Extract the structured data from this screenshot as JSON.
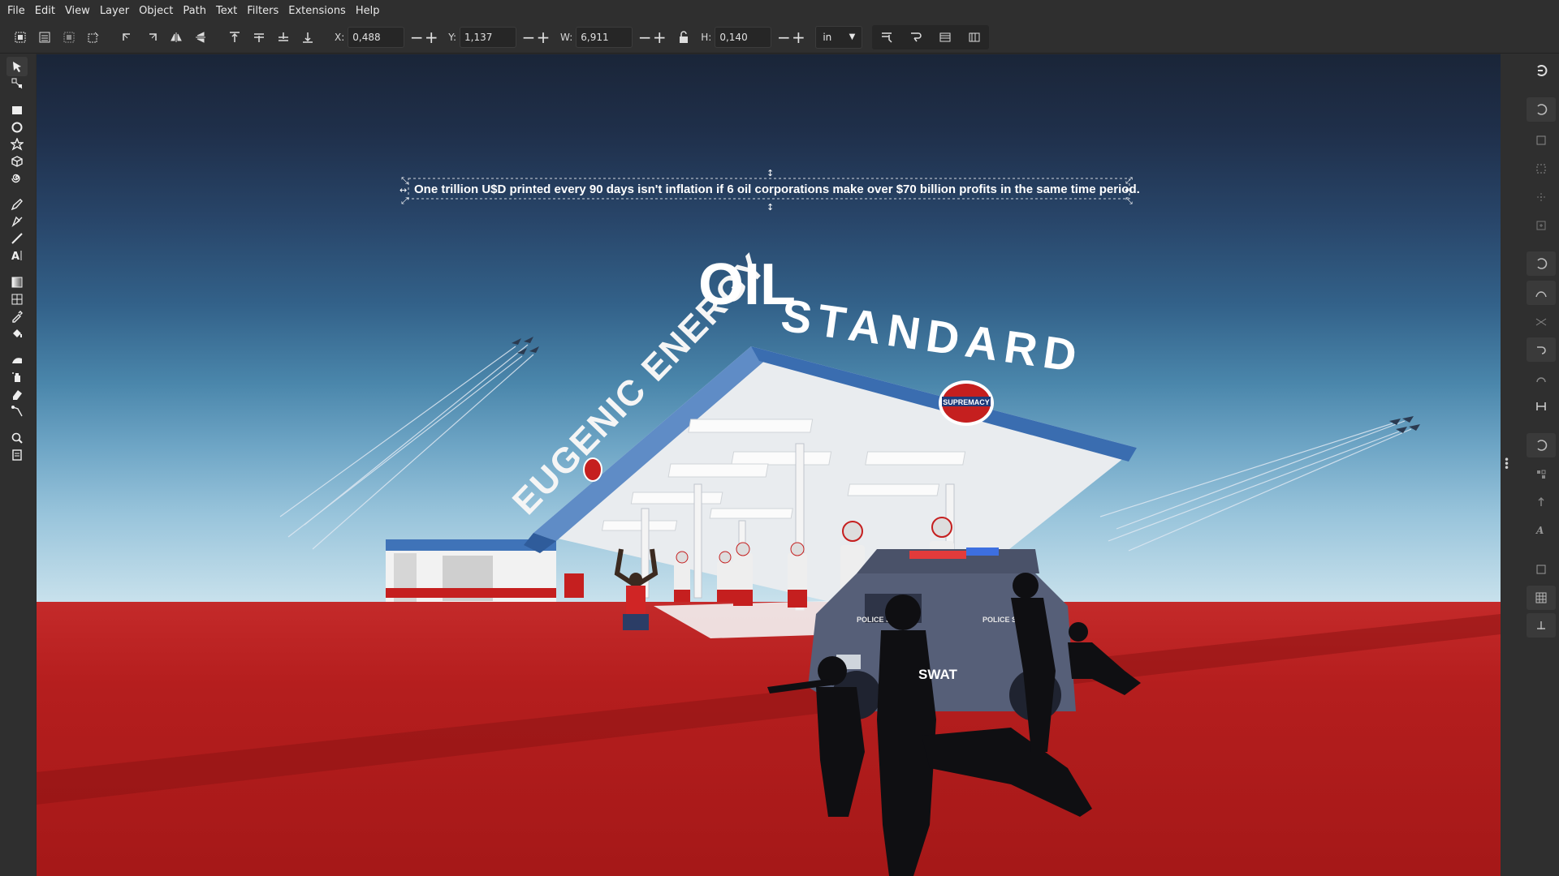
{
  "menu": [
    "File",
    "Edit",
    "View",
    "Layer",
    "Object",
    "Path",
    "Text",
    "Filters",
    "Extensions",
    "Help"
  ],
  "toolbar": {
    "x_label": "X:",
    "x_value": "0,488",
    "y_label": "Y:",
    "y_value": "1,137",
    "w_label": "W:",
    "w_value": "6,911",
    "h_label": "H:",
    "h_value": "0,140",
    "unit": "in"
  },
  "artwork": {
    "caption": "One trillion U$D printed every 90 days isn't inflation if 6 oil corporations make over $70 billion profits in the same time period.",
    "title_oil": "OIL",
    "title_standard": "STANDARD",
    "sign_left": "EUGENIC ENERGY",
    "badge": "SUPREMACY",
    "swat": "SWAT",
    "truck_label": "POLICE STATE",
    "colors": {
      "sky_top": "#1a2538",
      "sky_bottom": "#c8e1ec",
      "ground": "#b51e1e",
      "canopy_blue": "#3a6db0"
    }
  }
}
